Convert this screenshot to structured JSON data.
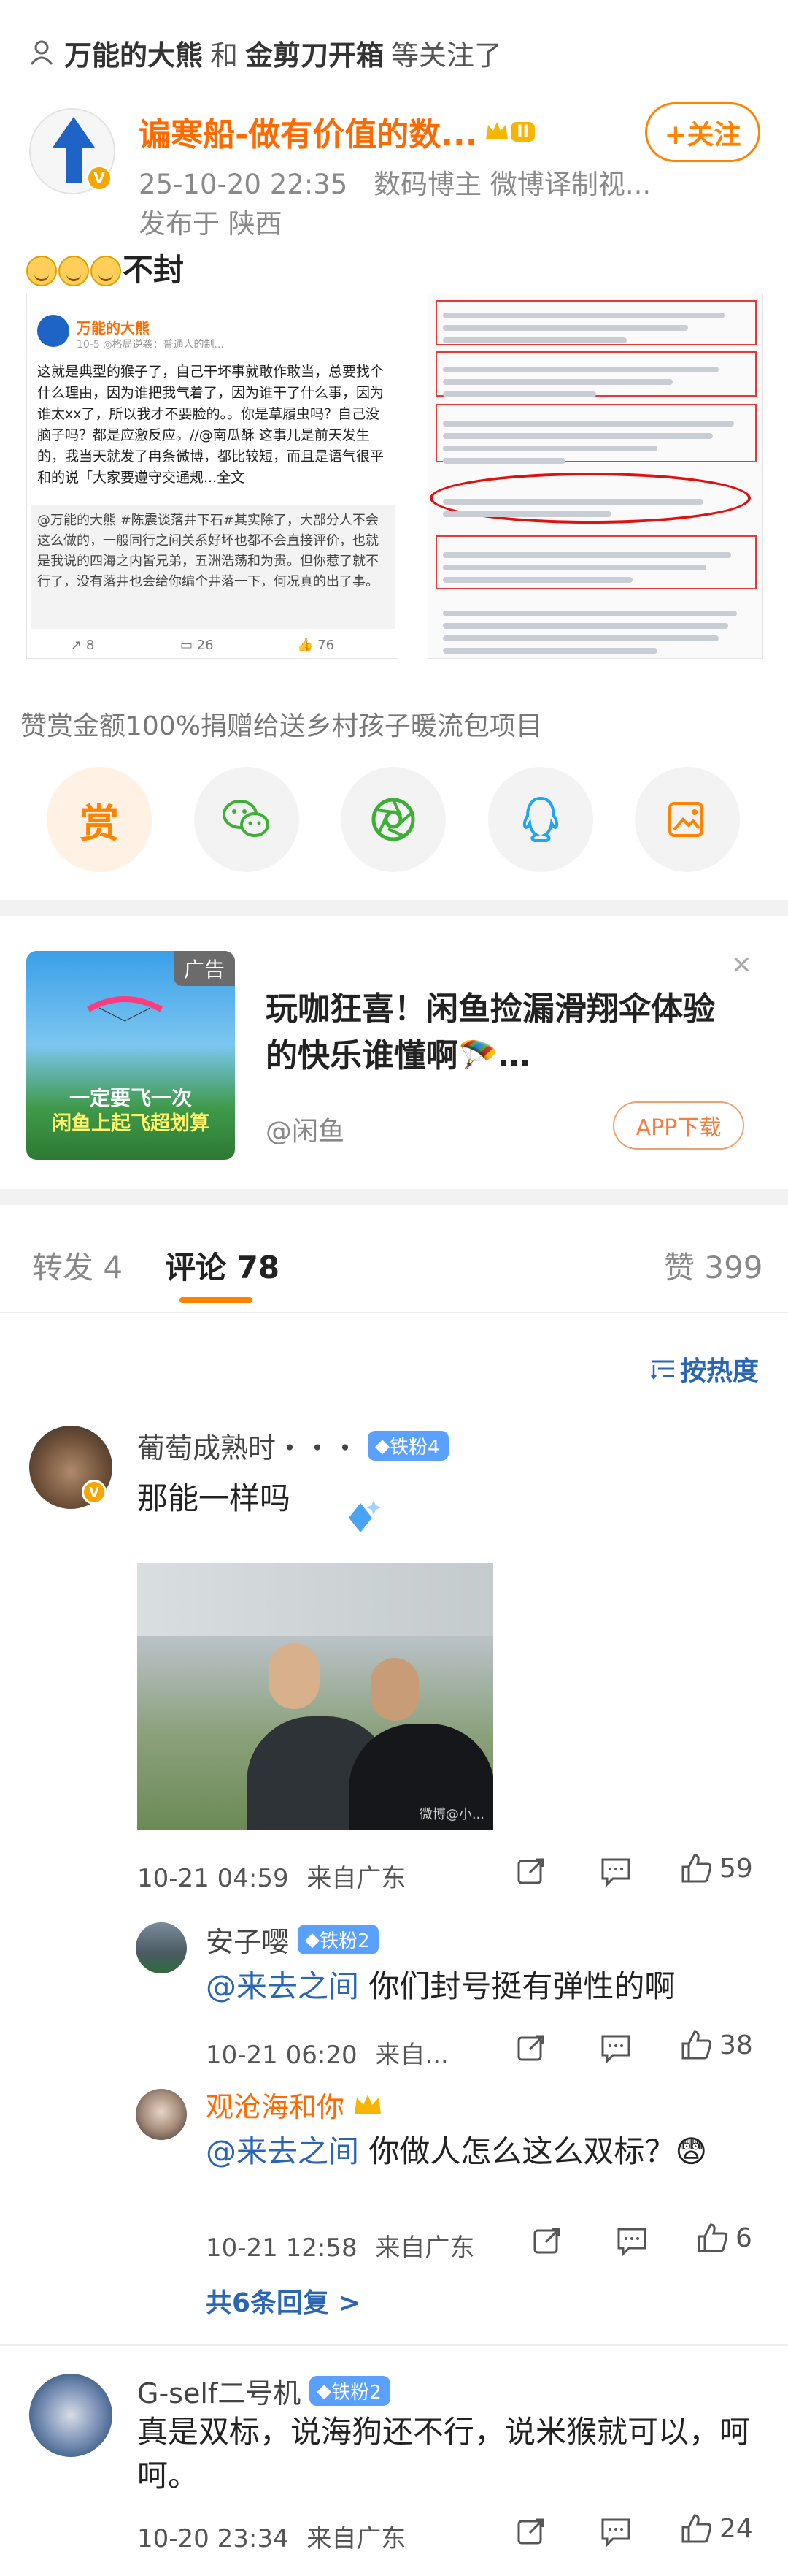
{
  "follow_notice": {
    "user1": "万能的大熊",
    "connector": "和",
    "user2": "金剪刀开箱",
    "suffix": "等关注了"
  },
  "author": {
    "name": "谝寒船-做有价值的数...",
    "level_badge": "II",
    "datetime": "25-10-20 22:35",
    "role": "数码博主 微博译制视...",
    "location": "发布于 陕西",
    "follow_label": "+关注"
  },
  "post": {
    "text": "不封"
  },
  "image1": {
    "user": "万能的大熊",
    "date": "10-5",
    "source": "◎格局逆袭：普通人的制...",
    "body": "这就是典型的猴子了，自己干坏事就敢作敢当，总要找个什么理由，因为谁把我气着了，因为谁干了什么事，因为谁太xx了，所以我才不要脸的。。你是草履虫吗？自己没脑子吗？都是应激反应。//@南瓜酥 这事儿是前天发生的，我当天就发了冉条微博，都比较短，而且是语气很平和的说「大家要遵守交通规...全文",
    "quote": "@万能的大熊 #陈震谈落井下石#其实除了，大部分人不会这么做的，一般同行之间关系好坏也都不会直接评价，也就是我说的四海之内皆兄弟，五洲浩荡和为贵。但你惹了就不行了，没有落井也会给你编个井落一下，何况真的出了事。",
    "reposts": "8",
    "comments": "26",
    "likes": "76"
  },
  "reward_text": "赞赏金额100%捐赠给送乡村孩子暖流包项目",
  "share_icons": [
    "reward-icon",
    "wechat-icon",
    "moments-icon",
    "qq-icon",
    "save-image-icon"
  ],
  "reward_label": "赏",
  "ad": {
    "tag": "广告",
    "banner_line1": "一定要飞一次",
    "banner_line2": "闲鱼上起飞超划算",
    "title": "玩咖狂喜！闲鱼捡漏滑翔伞体验的快乐谁懂啊🪂…",
    "source": "@闲鱼",
    "button": "APP下载"
  },
  "tabs": {
    "repost": "转发 4",
    "comment": "评论 78",
    "like": "赞 399"
  },
  "sort_label": "按热度",
  "comments": [
    {
      "name": "葡萄成熟时・・・",
      "badge": "铁粉4",
      "text": "那能一样吗",
      "time": "10-21 04:59",
      "from": "来自广东",
      "likes": "59",
      "image_caption": "微博@小..."
    },
    {
      "name": "安子嘤",
      "badge": "铁粉2",
      "mention": "@来去之间",
      "text": "你们封号挺有弹性的啊",
      "time": "10-21 06:20",
      "from": "来自...",
      "likes": "38"
    },
    {
      "name": "观沧海和你",
      "mention": "@来去之间",
      "text": "你做人怎么这么双标？😨",
      "time": "10-21 12:58",
      "from": "来自广东",
      "likes": "6",
      "more": "共6条回复 >"
    },
    {
      "name": "G-self二号机",
      "badge": "铁粉2",
      "text": "真是双标，说海狗还不行，说米猴就可以，呵呵。",
      "time": "10-20 23:34",
      "from": "来自广东",
      "likes": "24"
    }
  ],
  "colors": {
    "accent": "#ff8200",
    "link": "#2a66b4",
    "fan_badge": "#5aa1ff"
  }
}
